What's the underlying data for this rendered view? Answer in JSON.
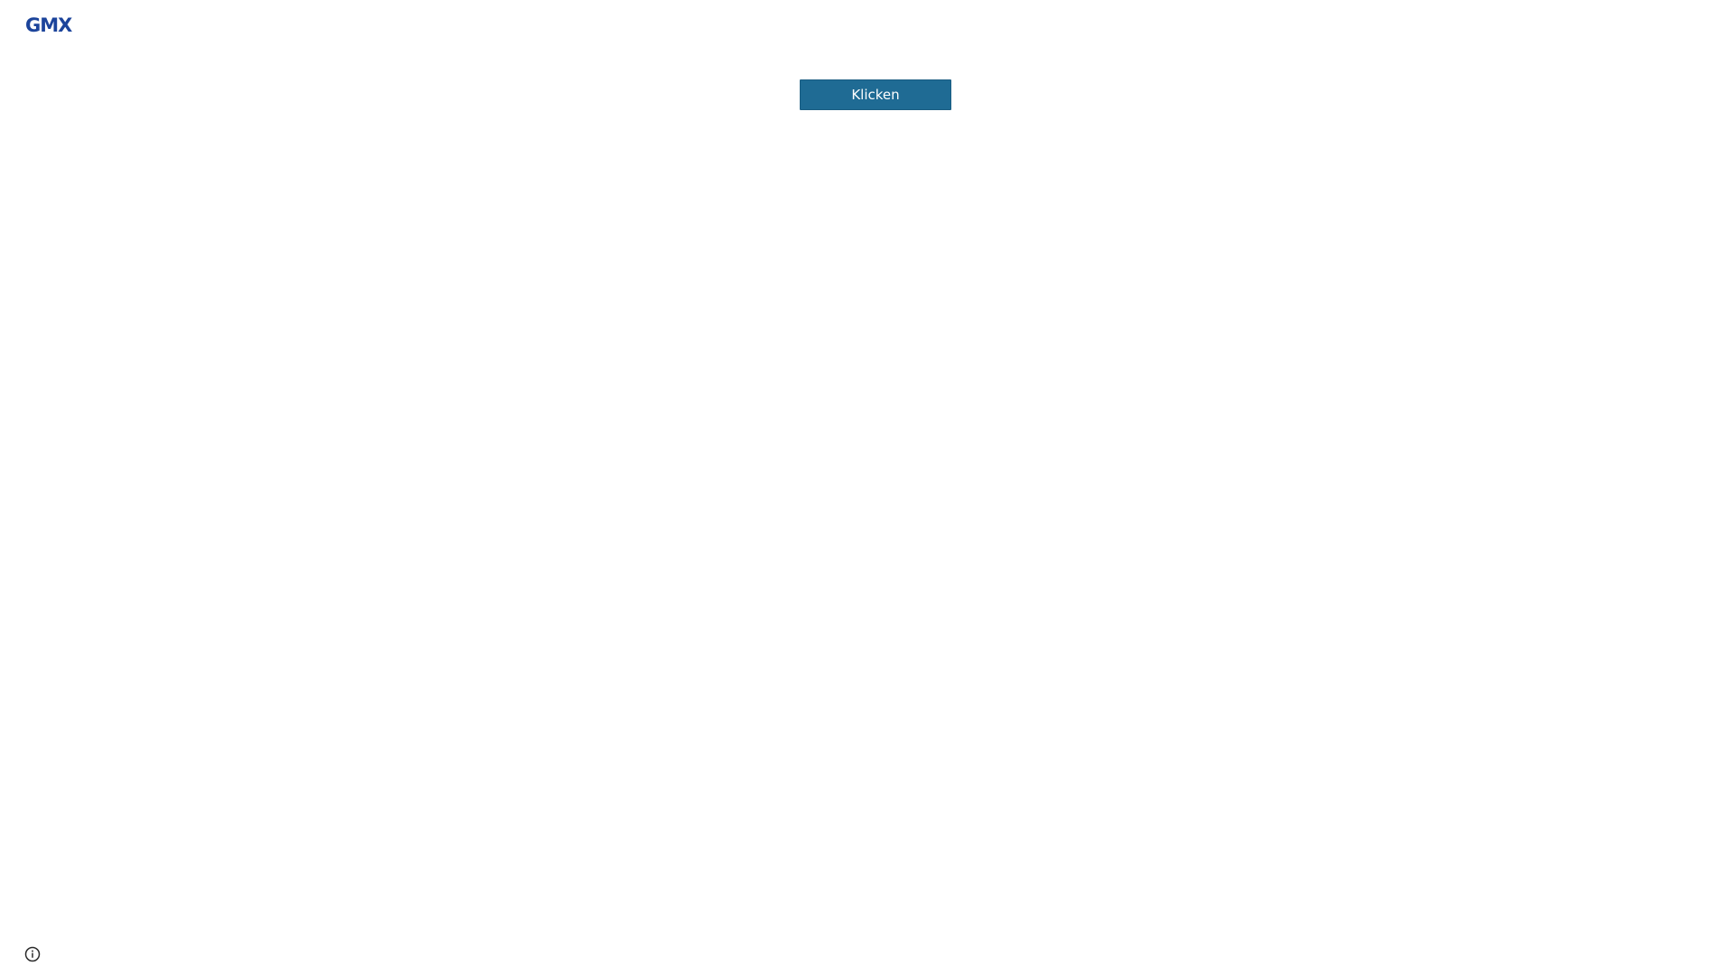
{
  "brand": {
    "logo_text": "GMX",
    "logo_color": "#1c449b"
  },
  "main": {
    "button_label": "Klicken",
    "button_color": "#1f6b94"
  },
  "footer": {
    "info_icon": "info-circle-icon"
  }
}
